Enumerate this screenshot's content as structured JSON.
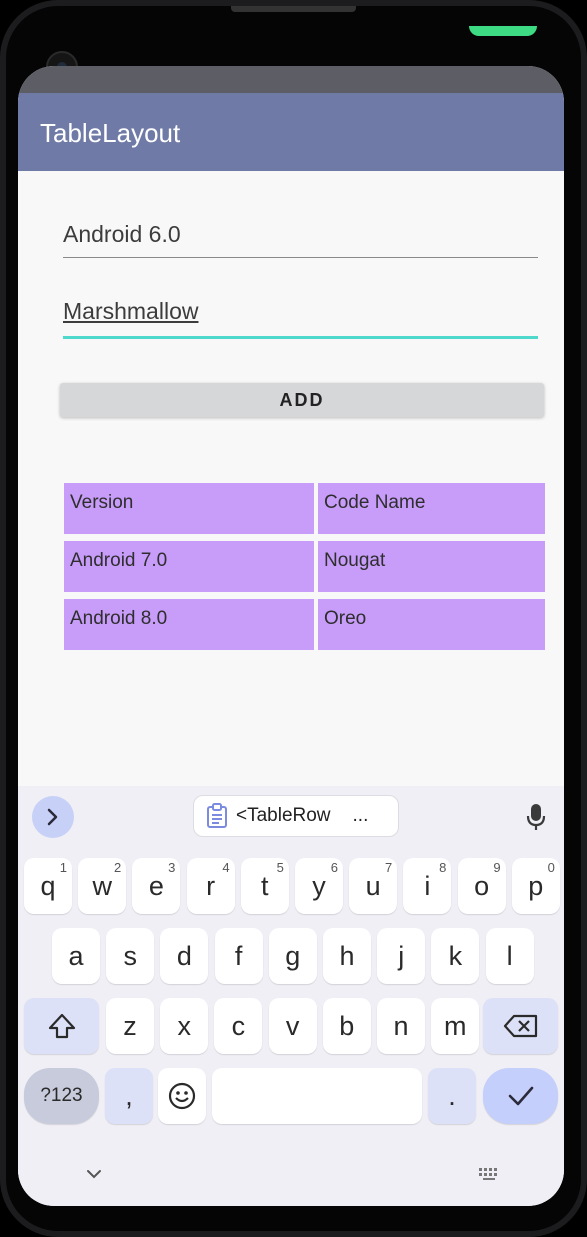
{
  "app": {
    "title": "TableLayout"
  },
  "form": {
    "version_value": "Android 6.0",
    "codename_value": "Marshmallow",
    "add_label": "ADD"
  },
  "table": {
    "rows": [
      [
        "Version",
        "Code Name"
      ],
      [
        "Android 7.0",
        "Nougat"
      ],
      [
        "Android 8.0",
        "Oreo"
      ]
    ]
  },
  "keyboard": {
    "suggestion": "<TableRow",
    "suggestion_more": "...",
    "rows": [
      [
        [
          "q",
          "1"
        ],
        [
          "w",
          "2"
        ],
        [
          "e",
          "3"
        ],
        [
          "r",
          "4"
        ],
        [
          "t",
          "5"
        ],
        [
          "y",
          "6"
        ],
        [
          "u",
          "7"
        ],
        [
          "i",
          "8"
        ],
        [
          "o",
          "9"
        ],
        [
          "p",
          "0"
        ]
      ],
      [
        [
          "a",
          ""
        ],
        [
          "s",
          ""
        ],
        [
          "d",
          ""
        ],
        [
          "f",
          ""
        ],
        [
          "g",
          ""
        ],
        [
          "h",
          ""
        ],
        [
          "j",
          ""
        ],
        [
          "k",
          ""
        ],
        [
          "l",
          ""
        ]
      ],
      [
        [
          "z",
          ""
        ],
        [
          "x",
          ""
        ],
        [
          "c",
          ""
        ],
        [
          "v",
          ""
        ],
        [
          "b",
          ""
        ],
        [
          "n",
          ""
        ],
        [
          "m",
          ""
        ]
      ]
    ],
    "mode_label": "?123",
    "comma": ",",
    "period": "."
  },
  "colors": {
    "app_bar": "#6f7ba6",
    "accent": "#4fd8cc",
    "table_cell": "#c89cf9",
    "button": "#d6d7d9"
  }
}
